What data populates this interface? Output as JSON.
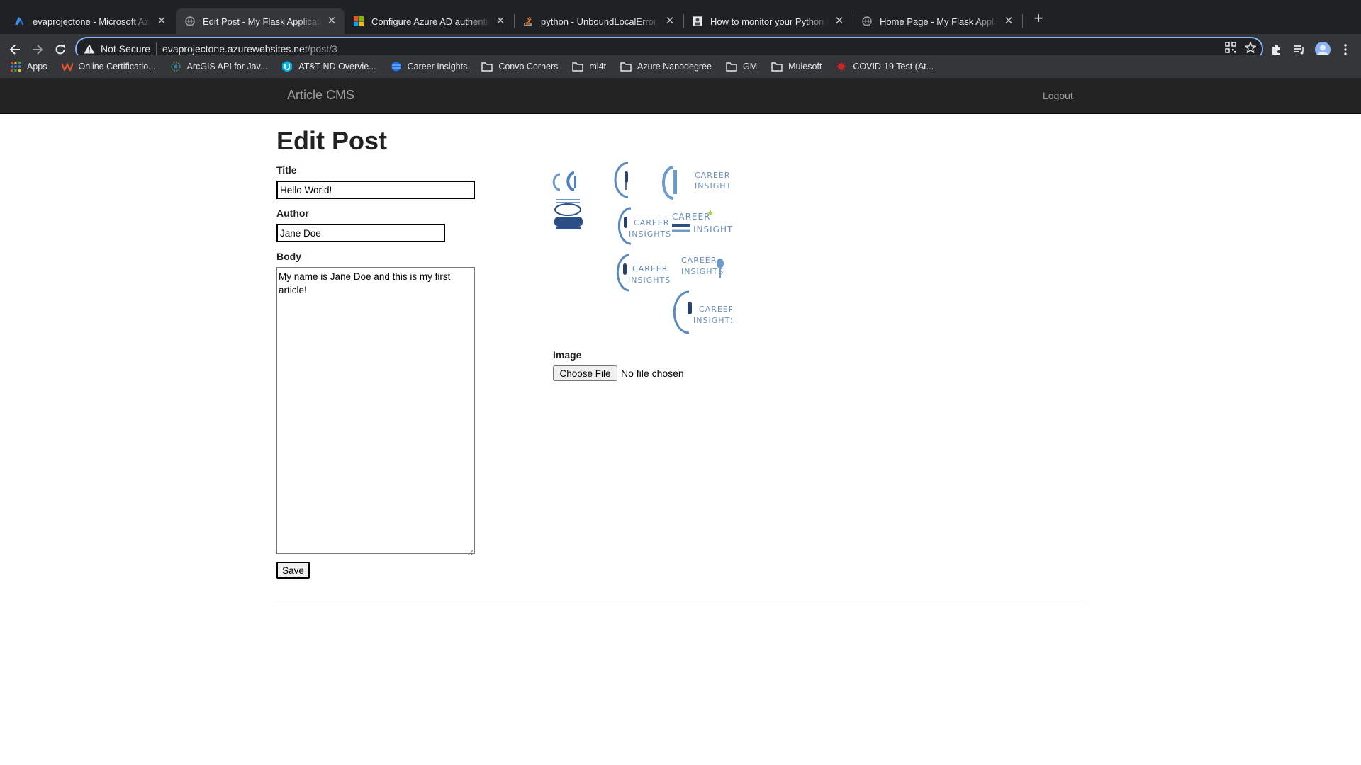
{
  "browser": {
    "tabs": [
      {
        "title": "evaprojectone - Microsoft Azure",
        "icon": "azure-icon",
        "active": false
      },
      {
        "title": "Edit Post - My Flask Application",
        "icon": "globe-icon",
        "active": true
      },
      {
        "title": "Configure Azure AD authentication",
        "icon": "microsoft-icon",
        "active": false
      },
      {
        "title": "python - UnboundLocalError: local",
        "icon": "stackoverflow-icon",
        "active": false
      },
      {
        "title": "How to monitor your Python Flask",
        "icon": "article-icon",
        "active": false
      },
      {
        "title": "Home Page - My Flask Application",
        "icon": "globe-icon",
        "active": false
      }
    ],
    "address": {
      "security_label": "Not Secure",
      "host": "evaprojectone.azurewebsites.net",
      "path": "/post/3"
    },
    "bookmarks": [
      {
        "label": "Apps",
        "icon": "apps-grid-icon"
      },
      {
        "label": "Online Certificatio...",
        "icon": "certification-icon"
      },
      {
        "label": "ArcGIS API for Jav...",
        "icon": "arcgis-icon"
      },
      {
        "label": "AT&T ND Overvie...",
        "icon": "udacity-icon"
      },
      {
        "label": "Career Insights",
        "icon": "globe-blue-icon"
      },
      {
        "label": "Convo Corners",
        "icon": "folder-icon"
      },
      {
        "label": "ml4t",
        "icon": "folder-icon"
      },
      {
        "label": "Azure Nanodegree",
        "icon": "folder-icon"
      },
      {
        "label": "GM",
        "icon": "folder-icon"
      },
      {
        "label": "Mulesoft",
        "icon": "folder-icon"
      },
      {
        "label": "COVID-19 Test (At...",
        "icon": "covid-icon"
      }
    ]
  },
  "navbar": {
    "brand": "Article CMS",
    "logout": "Logout"
  },
  "form": {
    "heading": "Edit Post",
    "title_label": "Title",
    "title_value": "Hello World!",
    "author_label": "Author",
    "author_value": "Jane Doe",
    "body_label": "Body",
    "body_value": "My name is Jane Doe and this is my first article!",
    "save_label": "Save",
    "image_label": "Image",
    "file_button_label": "Choose File",
    "file_status": "No file chosen"
  },
  "logo_sheet": {
    "words": [
      "CAREER",
      "INSIGHTS"
    ],
    "accent_color": "#5b89c2"
  },
  "colors": {
    "navbar_bg": "#222222",
    "chrome_dark": "#202124",
    "chrome_mid": "#35363a",
    "focus_ring": "#8ab4f8"
  }
}
